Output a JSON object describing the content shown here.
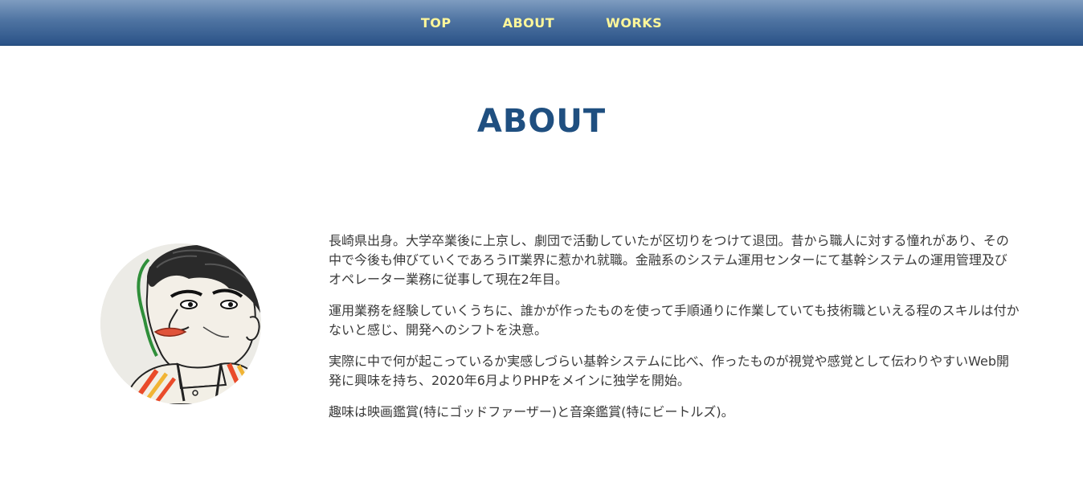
{
  "nav": {
    "items": [
      {
        "label": "TOP"
      },
      {
        "label": "ABOUT"
      },
      {
        "label": "WORKS"
      }
    ]
  },
  "about": {
    "title": "ABOUT",
    "paragraphs": [
      "長崎県出身。大学卒業後に上京し、劇団で活動していたが区切りをつけて退団。昔から職人に対する憧れがあり、その中で今後も伸びていくであろうIT業界に惹かれ就職。金融系のシステム運用センターにて基幹システムの運用管理及びオペレーター業務に従事して現在2年目。",
      "運用業務を経験していくうちに、誰かが作ったものを使って手順通りに作業していても技術職といえる程のスキルは付かないと感じ、開発へのシフトを決意。",
      "実際に中で何が起こっているか実感しづらい基幹システムに比べ、作ったものが視覚や感覚として伝わりやすいWeb開発に興味を持ち、2020年6月よりPHPをメインに独学を開始。",
      "趣味は映画鑑賞(特にゴッドファーザー)と音楽鑑賞(特にビートルズ)。"
    ]
  },
  "colors": {
    "nav_text": "#fff79a",
    "nav_gradient_top": "#7e9cc0",
    "nav_gradient_bottom": "#2a5287",
    "title": "#1f4f80",
    "body_text": "#3a3a3a"
  }
}
